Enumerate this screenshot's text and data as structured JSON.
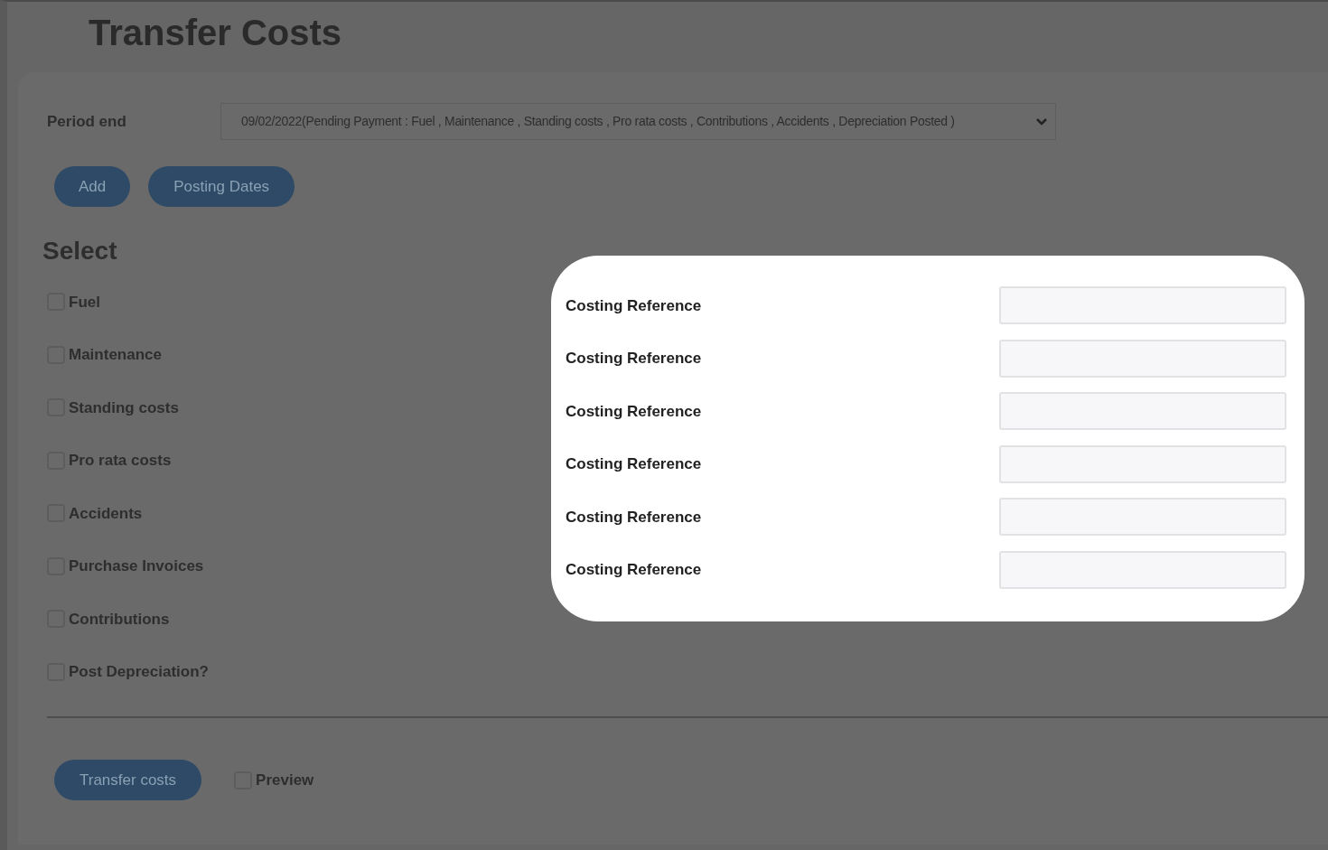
{
  "page_title": "Transfer Costs",
  "period_end": {
    "label": "Period end",
    "value": "09/02/2022(Pending Payment : Fuel , Maintenance , Standing costs , Pro rata costs , Contributions , Accidents , Depreciation Posted )"
  },
  "buttons": [
    "Add",
    "Posting Dates"
  ],
  "select": {
    "heading": "Select",
    "options": [
      {
        "label": "Fuel",
        "checked": false
      },
      {
        "label": "Maintenance",
        "checked": false
      },
      {
        "label": "Standing costs",
        "checked": false
      },
      {
        "label": "Pro rata costs",
        "checked": false
      },
      {
        "label": "Accidents",
        "checked": false
      },
      {
        "label": "Purchase Invoices",
        "checked": false
      },
      {
        "label": "Contributions",
        "checked": false
      },
      {
        "label": "Post Depreciation?",
        "checked": false
      }
    ]
  },
  "costing_references": [
    {
      "label": "Costing Reference"
    },
    {
      "label": "Costing Reference"
    },
    {
      "label": "Costing Reference"
    },
    {
      "label": "Costing Reference"
    },
    {
      "label": "Costing Reference"
    },
    {
      "label": "Costing Reference"
    }
  ],
  "footer": {
    "button": "Transfer costs",
    "preview": {
      "label": "Preview",
      "checked": false
    }
  }
}
